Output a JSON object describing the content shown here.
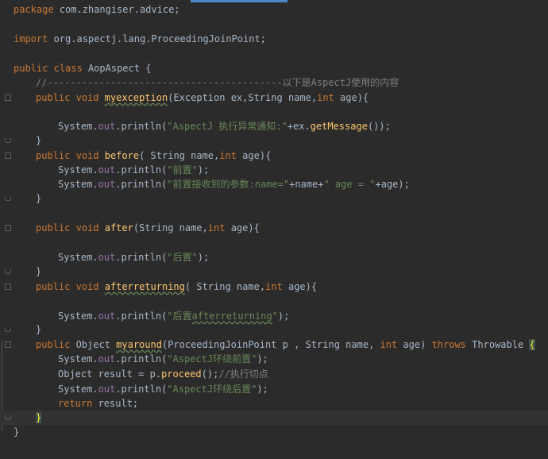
{
  "editor": {
    "line_01": {
      "kw": "package",
      "rest": " com.zhangiser.advice;"
    },
    "line_03": {
      "kw": "import",
      "rest": " org.aspectj.lang.ProceedingJoinPoint;"
    },
    "line_05": {
      "kw1": "public",
      "kw2": "class",
      "name": "AopAspect",
      "brace": " {"
    },
    "line_06": {
      "comment": "//-----------------------------------------以下是AspectJ使用的内容"
    },
    "line_07": {
      "kw1": "public",
      "kw2": "void",
      "method": "myexception",
      "p1type": "(Exception ",
      "p1": "ex",
      "sep": ",String ",
      "p2": "name",
      "kw3": "int",
      "p3": " age",
      "tail": "){"
    },
    "line_09": {
      "sys": "System.",
      "out": "out",
      "call": ".println(",
      "str": "\"AspectJ 执行异常通知:\"",
      "mid": "+ex.",
      "fn": "getMessage",
      "tail": "());"
    },
    "line_10": {
      "text": "}"
    },
    "line_11": {
      "kw1": "public",
      "kw2": "void",
      "method": "before",
      "p1type": "( String ",
      "p1": "name",
      "kw3": "int",
      "p2": " age",
      "tail": "){"
    },
    "line_12": {
      "sys": "System.",
      "out": "out",
      "call": ".println(",
      "str": "\"前置\"",
      "tail": ");"
    },
    "line_13": {
      "sys": "System.",
      "out": "out",
      "call": ".println(",
      "str": "\"前置接收到的参数:name=\"",
      "mid": "+name+",
      "str2": "\" age = \"",
      "tail": "+age);"
    },
    "line_14": {
      "text": "}"
    },
    "line_16": {
      "kw1": "public",
      "kw2": "void",
      "method": "after",
      "p1type": "(String ",
      "p1": "name",
      "kw3": "int",
      "p2": " age",
      "tail": "){"
    },
    "line_18": {
      "sys": "System.",
      "out": "out",
      "call": ".println(",
      "str": "\"后置\"",
      "tail": ");"
    },
    "line_19": {
      "text": "}"
    },
    "line_20": {
      "kw1": "public",
      "kw2": "void",
      "method": "afterreturning",
      "p1type": "( String ",
      "p1": "name",
      "kw3": "int",
      "p2": " age",
      "tail": "){"
    },
    "line_22": {
      "sys": "System.",
      "out": "out",
      "call": ".println(",
      "str_a": "\"后置",
      "str_b": "afterreturning",
      "str_c": "\"",
      "tail": ");"
    },
    "line_23": {
      "text": "}"
    },
    "line_24": {
      "kw1": "public",
      "type": " Object ",
      "method": "myaround",
      "p1type": "(ProceedingJoinPoint ",
      "p1": "p",
      "sep": " , String ",
      "p2": "name",
      "kw3": "int",
      "p3": " age",
      "close": ") ",
      "kw4": "throws",
      "exc": " Throwable ",
      "brace": "{"
    },
    "line_25": {
      "sys": "System.",
      "out": "out",
      "call": ".println(",
      "str": "\"AspectJ环绕前置\"",
      "tail": ");"
    },
    "line_26": {
      "type": "Object ",
      "var": "result = ",
      "p": "p",
      "dot": ".",
      "fn": "proceed",
      "tail": "();",
      "comment": "//执行切点"
    },
    "line_27": {
      "sys": "System.",
      "out": "out",
      "call": ".println(",
      "str": "\"AspectJ环绕后置\"",
      "tail": ");"
    },
    "line_28": {
      "kw": "return",
      "rest": " result;"
    },
    "line_29": {
      "brace": "}"
    },
    "line_30": {
      "text": "}"
    }
  },
  "colors": {
    "background": "#2b2b2b",
    "keyword": "#cc7832",
    "method": "#ffc66d",
    "string": "#6a8759",
    "comment": "#808080",
    "field": "#9876aa",
    "text": "#a9b7c6"
  }
}
